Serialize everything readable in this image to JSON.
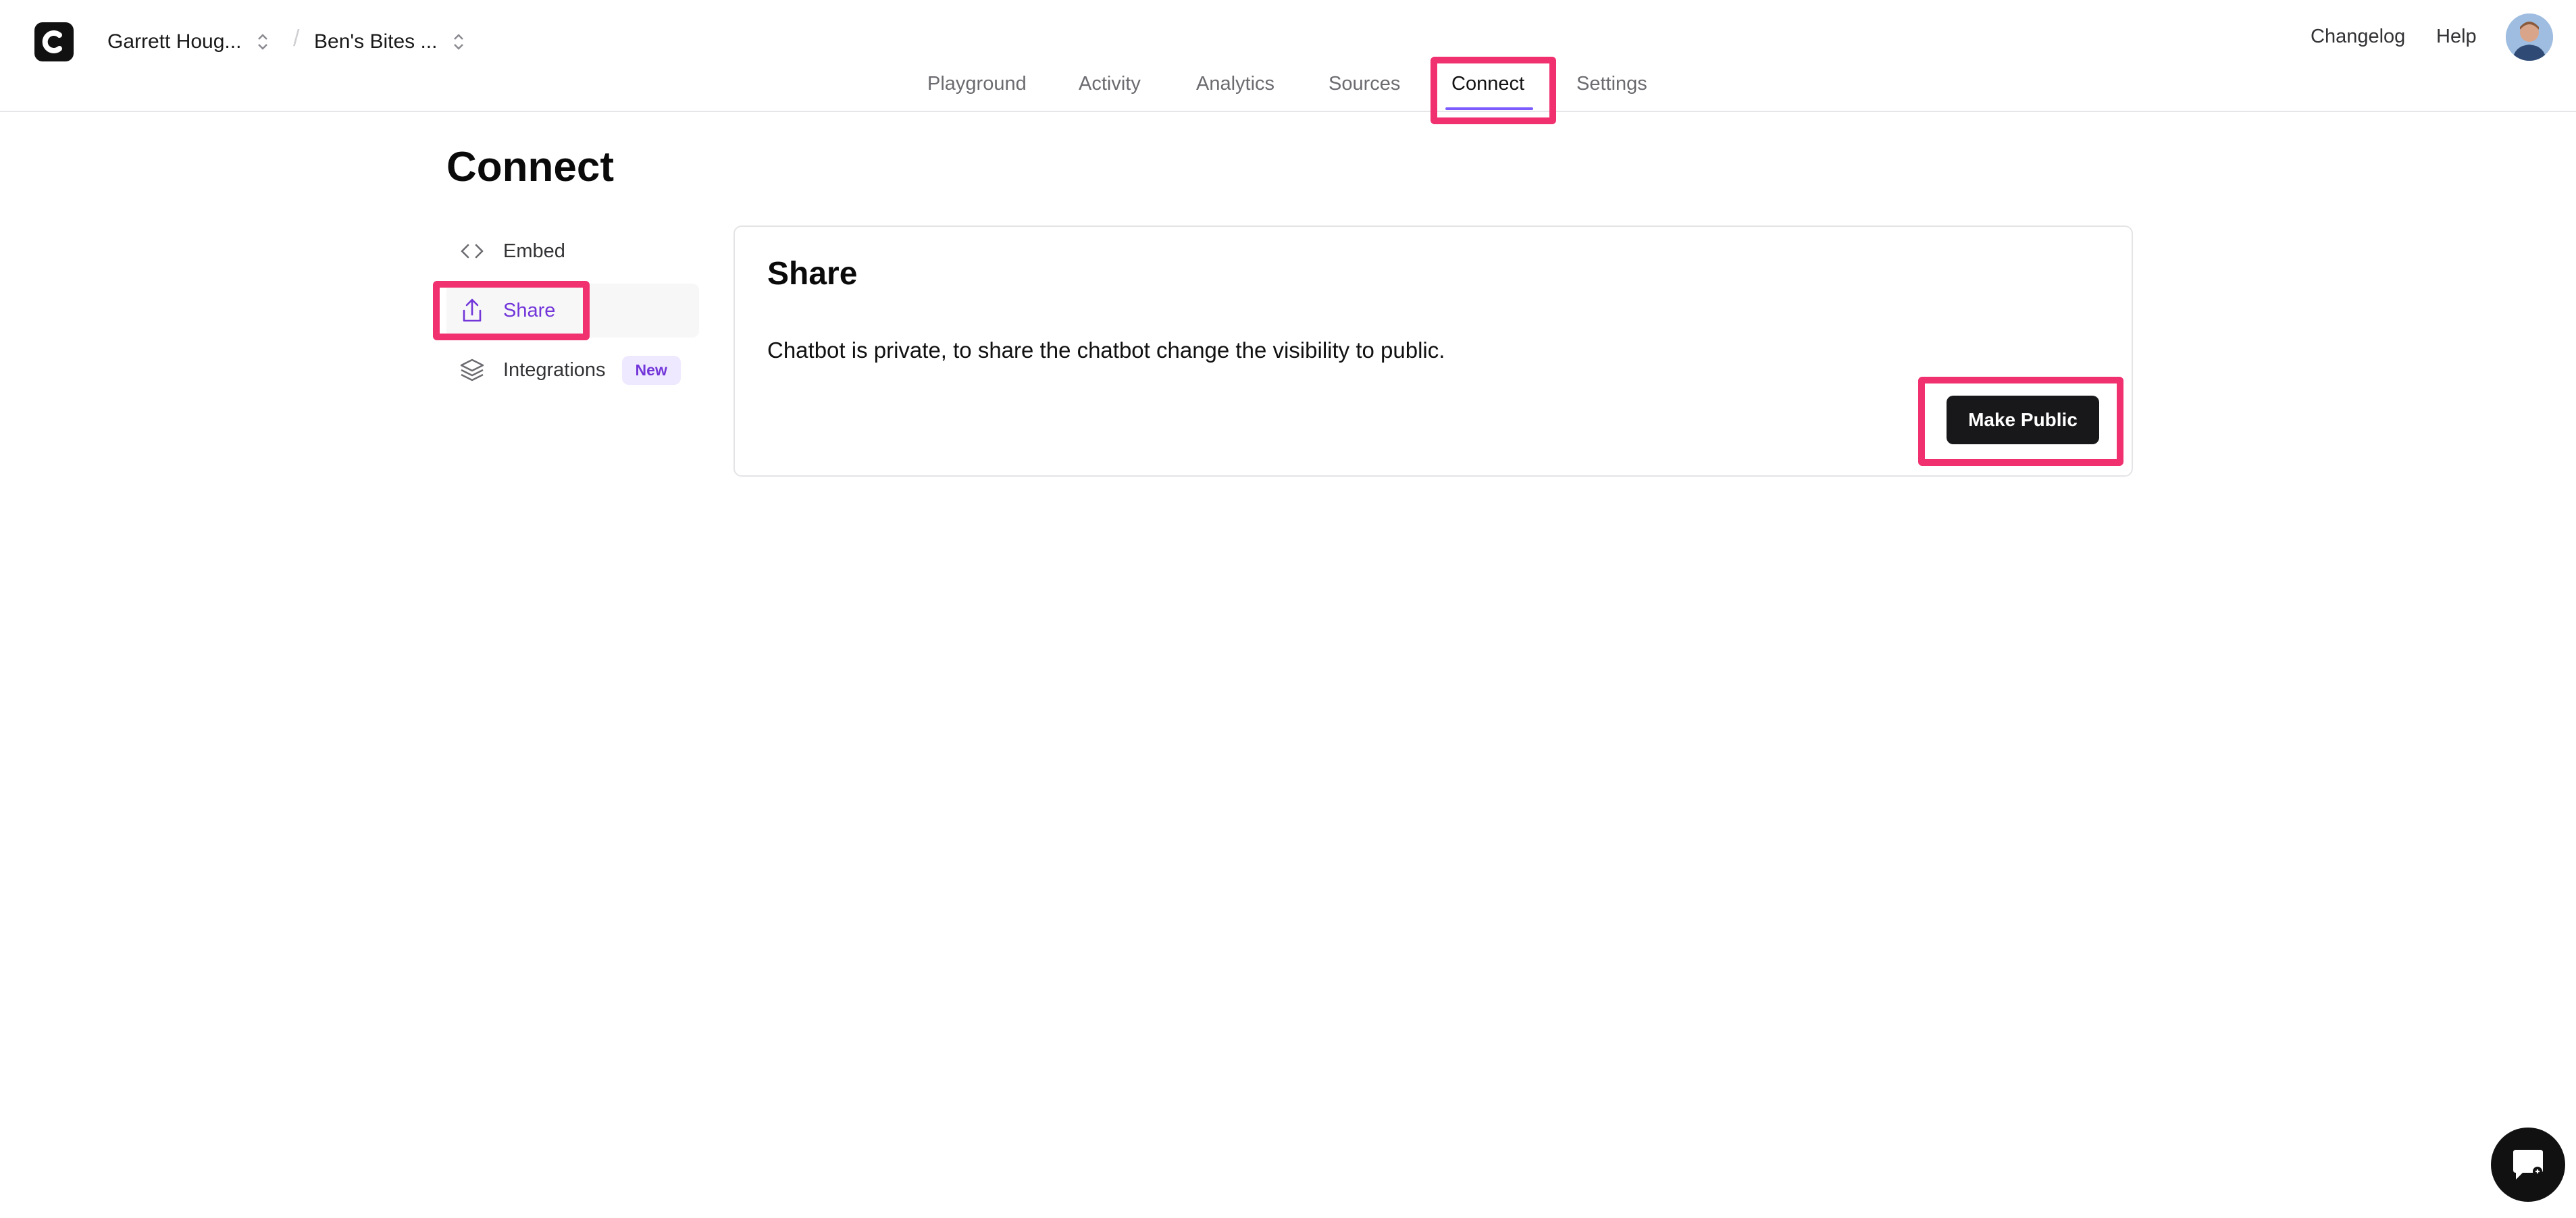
{
  "header": {
    "workspace": "Garrett Houg...",
    "chatbot": "Ben's Bites ...",
    "separator": "/",
    "nav": [
      "Playground",
      "Activity",
      "Analytics",
      "Sources",
      "Connect",
      "Settings"
    ],
    "active_nav": "Connect",
    "changelog": "Changelog",
    "help": "Help"
  },
  "page": {
    "title": "Connect"
  },
  "sidebar": {
    "items": [
      {
        "label": "Embed",
        "icon": "code-icon"
      },
      {
        "label": "Share",
        "icon": "share-icon"
      },
      {
        "label": "Integrations",
        "icon": "layers-icon",
        "badge": "New"
      }
    ],
    "active": "Share"
  },
  "share_card": {
    "title": "Share",
    "text": "Chatbot is private, to share the chatbot change the visibility to public.",
    "button": "Make Public"
  },
  "colors": {
    "accent": "#7c5cff",
    "active_text": "#7236d9",
    "highlight": "#f0306f",
    "button_bg": "#18181b"
  }
}
